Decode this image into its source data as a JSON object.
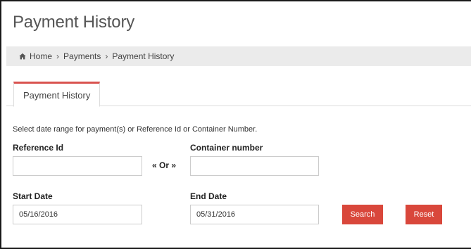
{
  "page": {
    "title": "Payment History"
  },
  "breadcrumb": {
    "home_label": "Home",
    "separator": "›",
    "items": [
      "Payments",
      "Payment History"
    ]
  },
  "tabs": [
    {
      "label": "Payment History",
      "active": true
    }
  ],
  "form": {
    "instructions": "Select date range for payment(s) or Reference Id or Container Number.",
    "reference_id": {
      "label": "Reference Id",
      "value": ""
    },
    "or_text": "« Or »",
    "container_number": {
      "label": "Container number",
      "value": ""
    },
    "start_date": {
      "label": "Start Date",
      "value": "05/16/2016"
    },
    "end_date": {
      "label": "End Date",
      "value": "05/31/2016"
    },
    "search_label": "Search",
    "reset_label": "Reset"
  },
  "colors": {
    "accent": "#d9473b",
    "breadcrumb_bg": "#ebebeb",
    "border": "#cccccc"
  }
}
